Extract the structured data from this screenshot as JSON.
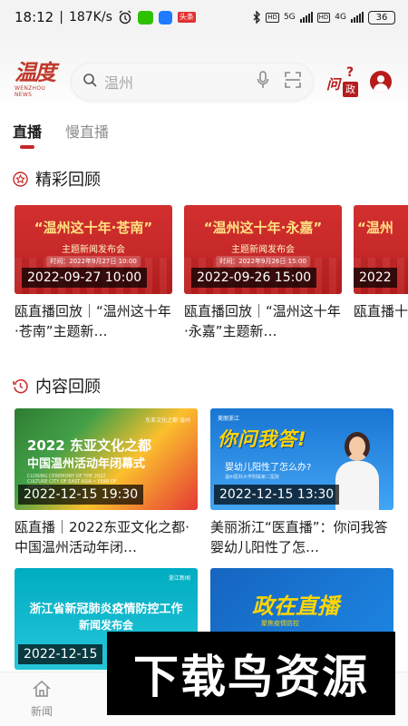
{
  "status_bar": {
    "time": "18:12",
    "speed": "187K/s",
    "app_badge": "头条",
    "hd1": "HD",
    "net1": "5G",
    "hd2": "HD",
    "net2": "4G",
    "battery": "36"
  },
  "header": {
    "logo_text": "温度",
    "logo_sub": "WENZHOU NEWS",
    "search_placeholder": "温州",
    "ask_text": "问",
    "ask_badge": "政",
    "ask_mark": "?"
  },
  "tabs": [
    {
      "label": "直播",
      "active": true
    },
    {
      "label": "慢直播",
      "active": false
    }
  ],
  "highlights": {
    "title": "精彩回顾",
    "items": [
      {
        "headline": "“温州这十年·苍南”",
        "subhead": "主题新闻发布会",
        "when": "时间：2022年9月27日 10:00",
        "stamp": "2022-09-27 10:00",
        "caption": "瓯直播回放｜“温州这十年·苍南”主题新…"
      },
      {
        "headline": "“温州这十年·永嘉”",
        "subhead": "主题新闻发布会",
        "when": "时间：2022年9月26日 15:00",
        "stamp": "2022-09-26 15:00",
        "caption": "瓯直播回放｜“温州这十年·永嘉”主题新…"
      },
      {
        "headline": "“温州",
        "subhead": "",
        "when": "",
        "stamp": "2022",
        "caption": "瓯直播十年·"
      }
    ]
  },
  "contents": {
    "title": "内容回顾",
    "items": [
      {
        "line1": "2022 东亚文化之都",
        "line2": "中国温州活动年闭幕式",
        "line3": "CLOSING CEREMONY OF THE 2022 CULTURE CITY OF EAST ASIA • YEAR OF WENZHOU",
        "badge": "东亚文化之都·温州",
        "stamp": "2022-12-15 19:30",
        "caption": "瓯直播｜2022东亚文化之都·中国温州活动年闭…"
      },
      {
        "line1": "你问我答!",
        "line2": "婴幼儿阳性了怎么办?",
        "line3": "温州医科大学附属第二医院",
        "badge": "美丽浙江",
        "stamp": "2022-12-15 13:30",
        "caption": "美丽浙江“医直播”：你问我答 婴幼儿阳性了怎…"
      },
      {
        "line1": "浙江省新冠肺炎疫情防控工作",
        "line2": "新闻发布会",
        "badge": "浙江新闻",
        "stamp": "2022-12-15",
        "caption": ""
      },
      {
        "line1": "政在直播",
        "line2": "聚焦疫情防控",
        "stamp": "",
        "caption": ""
      }
    ]
  },
  "bottom_nav": [
    {
      "label": "新闻",
      "icon": "home-icon"
    }
  ],
  "watermark": "下载鸟资源",
  "colors": {
    "brand": "#c62828",
    "tab_active": "#1a1a1a",
    "tab_inactive": "#8d8d8d"
  }
}
